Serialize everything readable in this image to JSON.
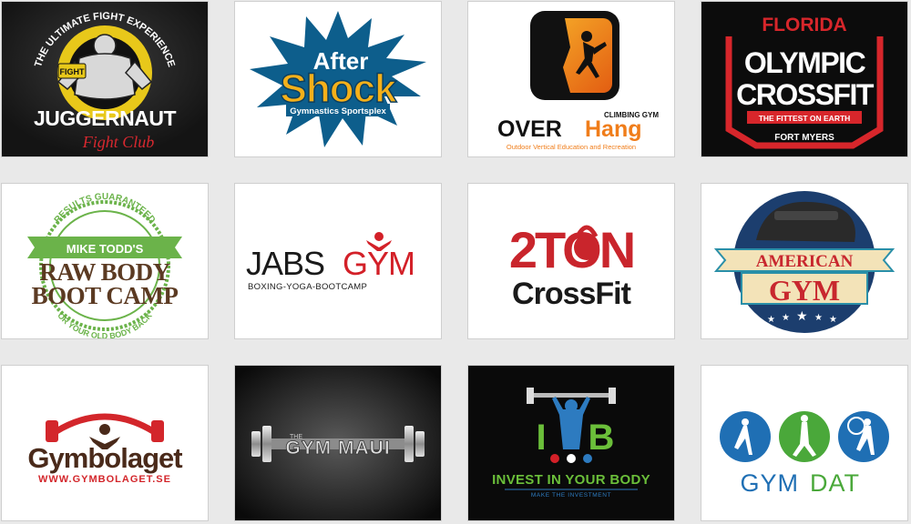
{
  "logos": [
    {
      "name": "juggernaut",
      "main": "JUGGERNAUT",
      "script": "Fight Club",
      "arc": "THE ULTIMATE FIGHT EXPERIENCE",
      "badge": "FIGHT",
      "colors": {
        "bg": "#1f1f1f",
        "accent": "#e8c81a",
        "script": "#d7282f"
      }
    },
    {
      "name": "aftershock",
      "main1": "After",
      "main2": "Shock",
      "tag": "Gymnastics Sportsplex",
      "colors": {
        "bg": "#ffffff",
        "burst": "#0d5e8c",
        "text": "#f4b01a"
      }
    },
    {
      "name": "overhang",
      "main1": "OVER",
      "main2": "Hang",
      "sup": "CLIMBING GYM",
      "tag": "Outdoor Vertical Education and Recreation",
      "colors": {
        "bg": "#ffffff",
        "accent": "#f07d1a",
        "dark": "#1a1a1a"
      }
    },
    {
      "name": "florida-olympic-crossfit",
      "top": "FLORIDA",
      "line1": "OLYMPIC",
      "line2": "CROSSFIT",
      "band": "THE FITTEST ON EARTH",
      "bottom": "FORT MYERS",
      "colors": {
        "bg": "#0c0c0c",
        "red": "#d7262b",
        "white": "#ffffff"
      }
    },
    {
      "name": "raw-body-boot-camp",
      "top": "RESULTS GUARANTEED",
      "ribbon": "MIKE TODD'S",
      "line1": "RAW BODY",
      "line2": "BOOT CAMP",
      "bottom": "OR YOUR OLD BODY BACK",
      "colors": {
        "bg": "#ffffff",
        "green": "#6bb34a",
        "brown": "#5b3a22"
      }
    },
    {
      "name": "jabsgym",
      "main1": "JABS",
      "main2": "GYM",
      "tag": "BOXING-YOGA-BOOTCAMP",
      "colors": {
        "bg": "#ffffff",
        "dark": "#1a1a1a",
        "red": "#d32028"
      }
    },
    {
      "name": "2ton-crossfit",
      "line1": "2TON",
      "line2": "CrossFit",
      "colors": {
        "bg": "#ffffff",
        "red": "#c9252c",
        "dark": "#1a1a1a"
      }
    },
    {
      "name": "american-gym",
      "main1": "AMERICAN",
      "main2": "GYM",
      "colors": {
        "bg": "#ffffff",
        "navy": "#1c3e6e",
        "red": "#c8272e",
        "cream": "#f3e3b8",
        "teal": "#2a8fa8"
      }
    },
    {
      "name": "gymbolaget",
      "main": "Gymbolaget",
      "url": "WWW.GYMBOLAGET.SE",
      "colors": {
        "bg": "#ffffff",
        "red": "#d3262b",
        "brown": "#4a2a1a"
      }
    },
    {
      "name": "the-gym-maui",
      "pre": "THE",
      "main": "GYM MAUI",
      "colors": {
        "bg": "#111111",
        "metal": "#c9c9c9"
      }
    },
    {
      "name": "invest-in-your-body",
      "main": "INVEST IN YOUR BODY",
      "tag": "MAKE THE INVESTMENT",
      "letters": "IYB",
      "colors": {
        "bg": "#0a0a0a",
        "blue": "#2d7bc0",
        "green": "#6bbf3a"
      }
    },
    {
      "name": "gymdat",
      "main1": "GYM",
      "main2": "DAT",
      "colors": {
        "bg": "#ffffff",
        "blue": "#1f6fb4",
        "green": "#4aa83a"
      }
    }
  ]
}
